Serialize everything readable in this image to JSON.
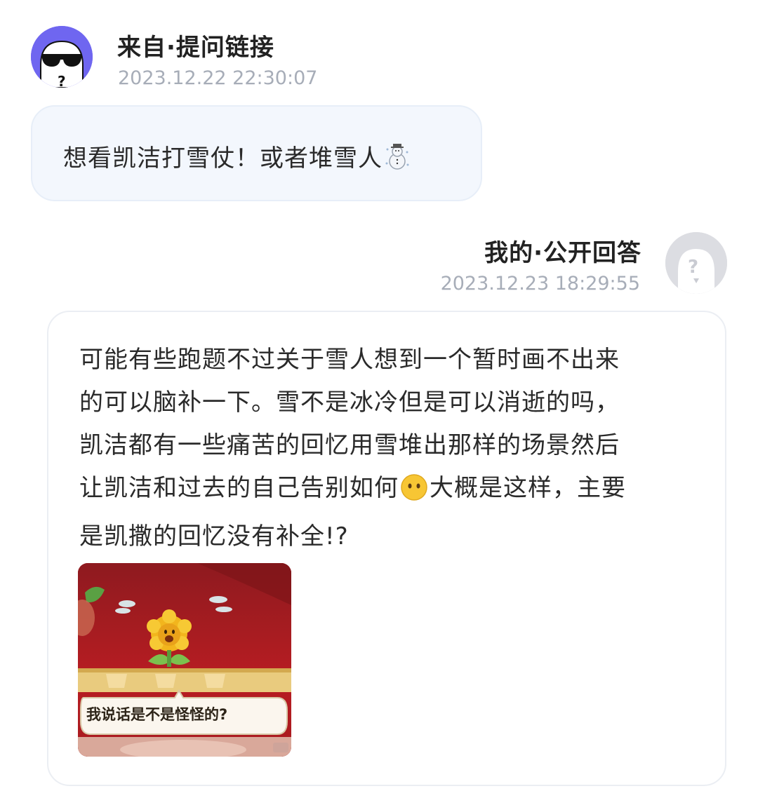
{
  "question": {
    "avatar_icon": "sunglasses-ghost-avatar",
    "avatar_color": "#6f66f0",
    "title": "来自·提问链接",
    "timestamp": "2023.12.22 22:30:07",
    "text": "想看凯洁打雪仗！或者堆雪人",
    "emoji": "snowman-icon"
  },
  "answer": {
    "title": "我的·公开回答",
    "timestamp": "2023.12.23 18:29:55",
    "avatar_icon": "anonymous-question-avatar",
    "lines": [
      "可能有些跑题不过关于雪人想到一个暂时画不出来",
      "的可以脑补一下。雪不是冰冷但是可以消逝的吗，",
      "凯洁都有一些痛苦的回忆用雪堆出那样的场景然后",
      "让凯洁和过去的自己告别如何",
      "大概是这样，主要",
      "是凯撒的回忆没有补全!?"
    ],
    "inline_emoji": "no-mouth-face-icon",
    "image": {
      "description_icon": "sunflower-meme-image",
      "caption": "我说话是不是怪怪的?"
    }
  },
  "colors": {
    "meta_gray": "#a7adb8",
    "bubble_bg": "#f3f7fd",
    "card_border": "#ebeef3"
  }
}
